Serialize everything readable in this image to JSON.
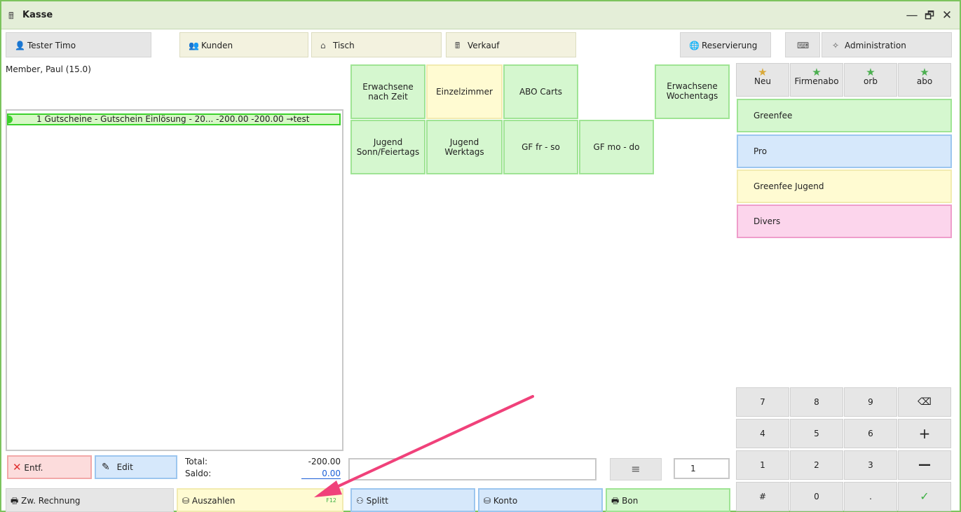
{
  "window": {
    "title": "Kasse",
    "controls": {
      "minimize": "—",
      "restore": "🗗",
      "close": "✕"
    }
  },
  "nav": {
    "user": "Tester Timo",
    "kunden": "Kunden",
    "tisch": "Tisch",
    "verkauf": "Verkauf",
    "reservierung": "Reservierung",
    "administration": "Administration"
  },
  "member": "Member, Paul (15.0)",
  "receipt_rows": [
    {
      "text": "1  Gutscheine - Gutschein Einlösung - 20...   -200.00  -200.00 →test"
    }
  ],
  "tiles": [
    {
      "label": "Erwachsene nach Zeit"
    },
    {
      "label": "Einzelzimmer"
    },
    {
      "label": "ABO Carts"
    },
    {
      "label": "Erwachsene Wochentags"
    },
    {
      "label": "Jugend Sonn/Feiertags"
    },
    {
      "label": "Jugend Werktags"
    },
    {
      "label": "GF fr - so"
    },
    {
      "label": "GF mo - do"
    }
  ],
  "favorites": [
    {
      "label": "Neu",
      "star_color": "#d9a93a"
    },
    {
      "label": "Firmenabo",
      "star_color": "#4caf50"
    },
    {
      "label": "orb",
      "star_color": "#4caf50"
    },
    {
      "label": "abo",
      "star_color": "#4caf50"
    }
  ],
  "categories": [
    {
      "label": "Greenfee"
    },
    {
      "label": "Pro"
    },
    {
      "label": "Greenfee Jugend"
    },
    {
      "label": "Divers"
    }
  ],
  "keypad": {
    "rows": [
      [
        "7",
        "8",
        "9",
        "⌫"
      ],
      [
        "4",
        "5",
        "6",
        "+"
      ],
      [
        "1",
        "2",
        "3",
        "—"
      ],
      [
        "#",
        "0",
        ".",
        "✓"
      ]
    ]
  },
  "actions": {
    "entf": "Entf.",
    "edit": "Edit",
    "total_label": "Total:",
    "total_value": "-200.00",
    "saldo_label": "Saldo:",
    "saldo_value": "0.00",
    "quantity": "1",
    "menu_icon": "≡",
    "zw_rechnung": "Zw. Rechnung",
    "auszahlen": "Auszahlen",
    "auszahlen_hotkey": "F12",
    "splitt": "Splitt",
    "konto": "Konto",
    "bon": "Bon"
  },
  "colors": {
    "accent_green": "#3cd12c",
    "annotation_arrow": "#f0417a"
  }
}
